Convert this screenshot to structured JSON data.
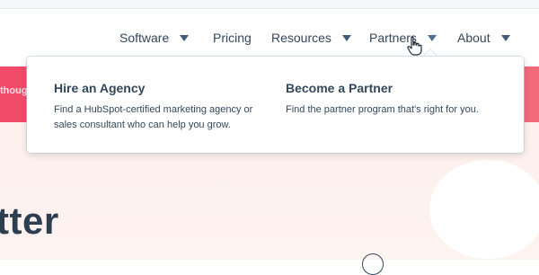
{
  "nav": {
    "items": [
      {
        "label": "Software",
        "has_dropdown": true
      },
      {
        "label": "Pricing",
        "has_dropdown": false
      },
      {
        "label": "Resources",
        "has_dropdown": true
      },
      {
        "label": "Partners",
        "has_dropdown": true,
        "active": true
      },
      {
        "label": "About",
        "has_dropdown": true
      }
    ]
  },
  "dropdown": {
    "columns": [
      {
        "title": "Hire an Agency",
        "description": "Find a HubSpot-certified marketing agency or sales consultant who can help you grow."
      },
      {
        "title": "Become a Partner",
        "description": "Find the partner program that's right for you."
      }
    ]
  },
  "banner": {
    "text_fragment": "thoug"
  },
  "hero": {
    "title_fragment": "tter"
  },
  "colors": {
    "banner": "#f24a68",
    "hero_bg": "#fcf0ed",
    "text": "#33475b",
    "caret": "#425b76"
  }
}
